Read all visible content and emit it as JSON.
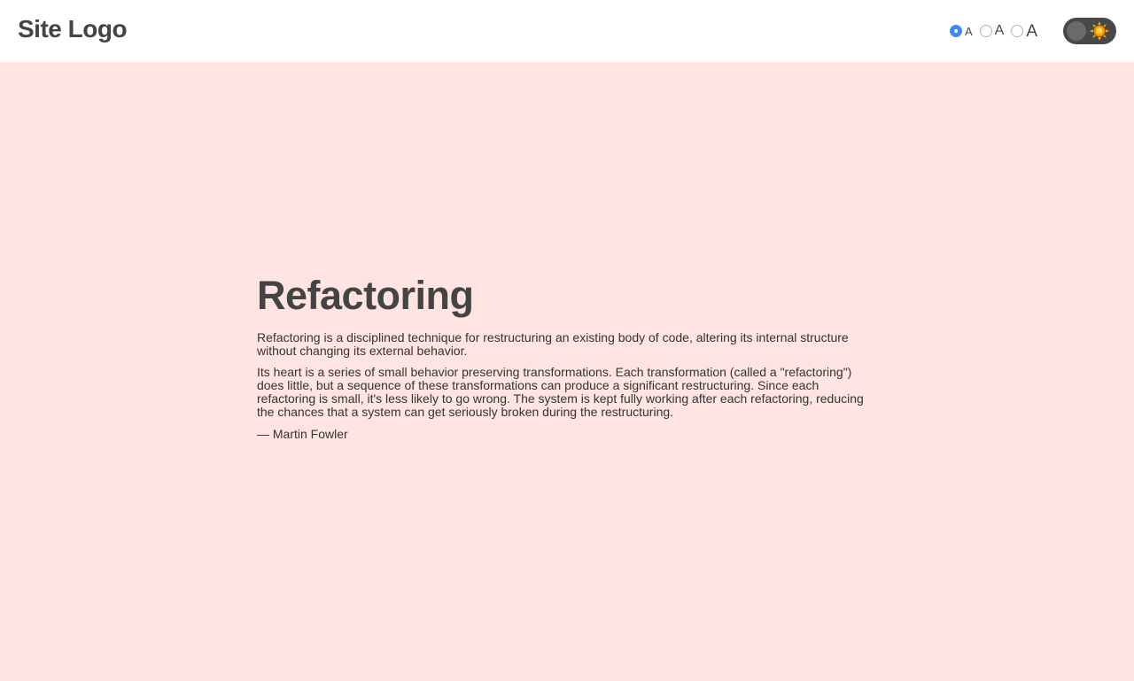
{
  "header": {
    "logo": "Site Logo",
    "font_size_options": [
      {
        "label": "A",
        "checked": true
      },
      {
        "label": "A",
        "checked": false
      },
      {
        "label": "A",
        "checked": false
      }
    ],
    "theme_toggle": {
      "icon": "sun-icon",
      "state": "light"
    }
  },
  "content": {
    "title": "Refactoring",
    "paragraphs": [
      "Refactoring is a disciplined technique for restructuring an existing body of code, altering its internal structure without changing its external behavior.",
      "Its heart is a series of small behavior preserving transformations. Each transformation (called a \"refactoring\") does little, but a sequence of these transformations can produce a significant restructuring. Since each refactoring is small, it's less likely to go wrong. The system is kept fully working after each refactoring, reducing the chances that a system can get seriously broken during the restructuring."
    ],
    "author": "— Martin Fowler"
  },
  "colors": {
    "background": "#ffe4e1",
    "header_bg": "#ffffff",
    "text": "#444444",
    "radio_accent": "#3b8cf0",
    "toggle_bg": "#484848",
    "sun": "#f5b400"
  }
}
